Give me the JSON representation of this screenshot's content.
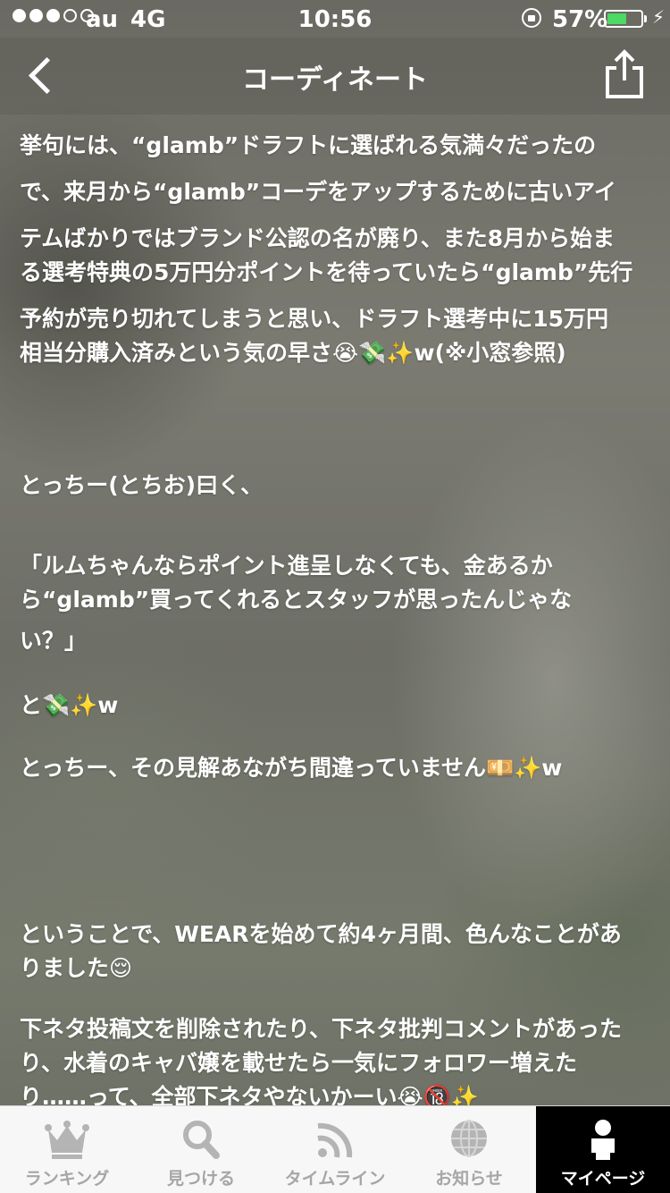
{
  "status_bar": {
    "carrier": "au",
    "network": "4G",
    "time": "10:56",
    "battery_text": "57%",
    "battery_level": 0.57,
    "battery_color": "#4cd964",
    "signal_bars_filled": 3,
    "signal_bars_total": 5
  },
  "nav": {
    "title": "コーディネート",
    "back_icon": "chevron-left-icon",
    "share_icon": "share-icon"
  },
  "content": {
    "lines": [
      "挙句には、“glamb”ドラフトに選ばれる気満々だったの",
      "で、来月から“glamb”コーデをアップするために古いアイ",
      "テムばかりではブランド公認の名が廃り、また8月から始ま",
      "る選考特典の5万円分ポイントを待っていたら“glamb”先行",
      "予約が売り切れてしまうと思い、ドラフト選考中に15万円",
      "相当分購入済みという気の早さ😭💸✨w(※小窓参照)",
      "とっちー(とちお)曰く、",
      "「ルムちゃんならポイント進呈しなくても、金あるか",
      "ら“glamb”買ってくれるとスタッフが思ったんじゃな",
      "い？」",
      "と💸✨w",
      "とっちー、その見解あながち間違っていません💴✨w",
      "ということで、WEARを始めて約4ヶ月間、色んなことがあ",
      "りました😌",
      "下ネタ投稿文を削除されたり、下ネタ批判コメントがあった",
      "り、水着のキャバ嬢を載せたら一気にフォロワー増えた",
      "り……って、全部下ネタやないかーい😭🔞✨"
    ]
  },
  "tabs": [
    {
      "label": "ランキング",
      "icon": "crown-icon",
      "active": false
    },
    {
      "label": "見つける",
      "icon": "search-icon",
      "active": false
    },
    {
      "label": "タイムライン",
      "icon": "rss-icon",
      "active": false
    },
    {
      "label": "お知らせ",
      "icon": "globe-icon",
      "active": false
    },
    {
      "label": "マイページ",
      "icon": "person-icon",
      "active": true
    }
  ]
}
